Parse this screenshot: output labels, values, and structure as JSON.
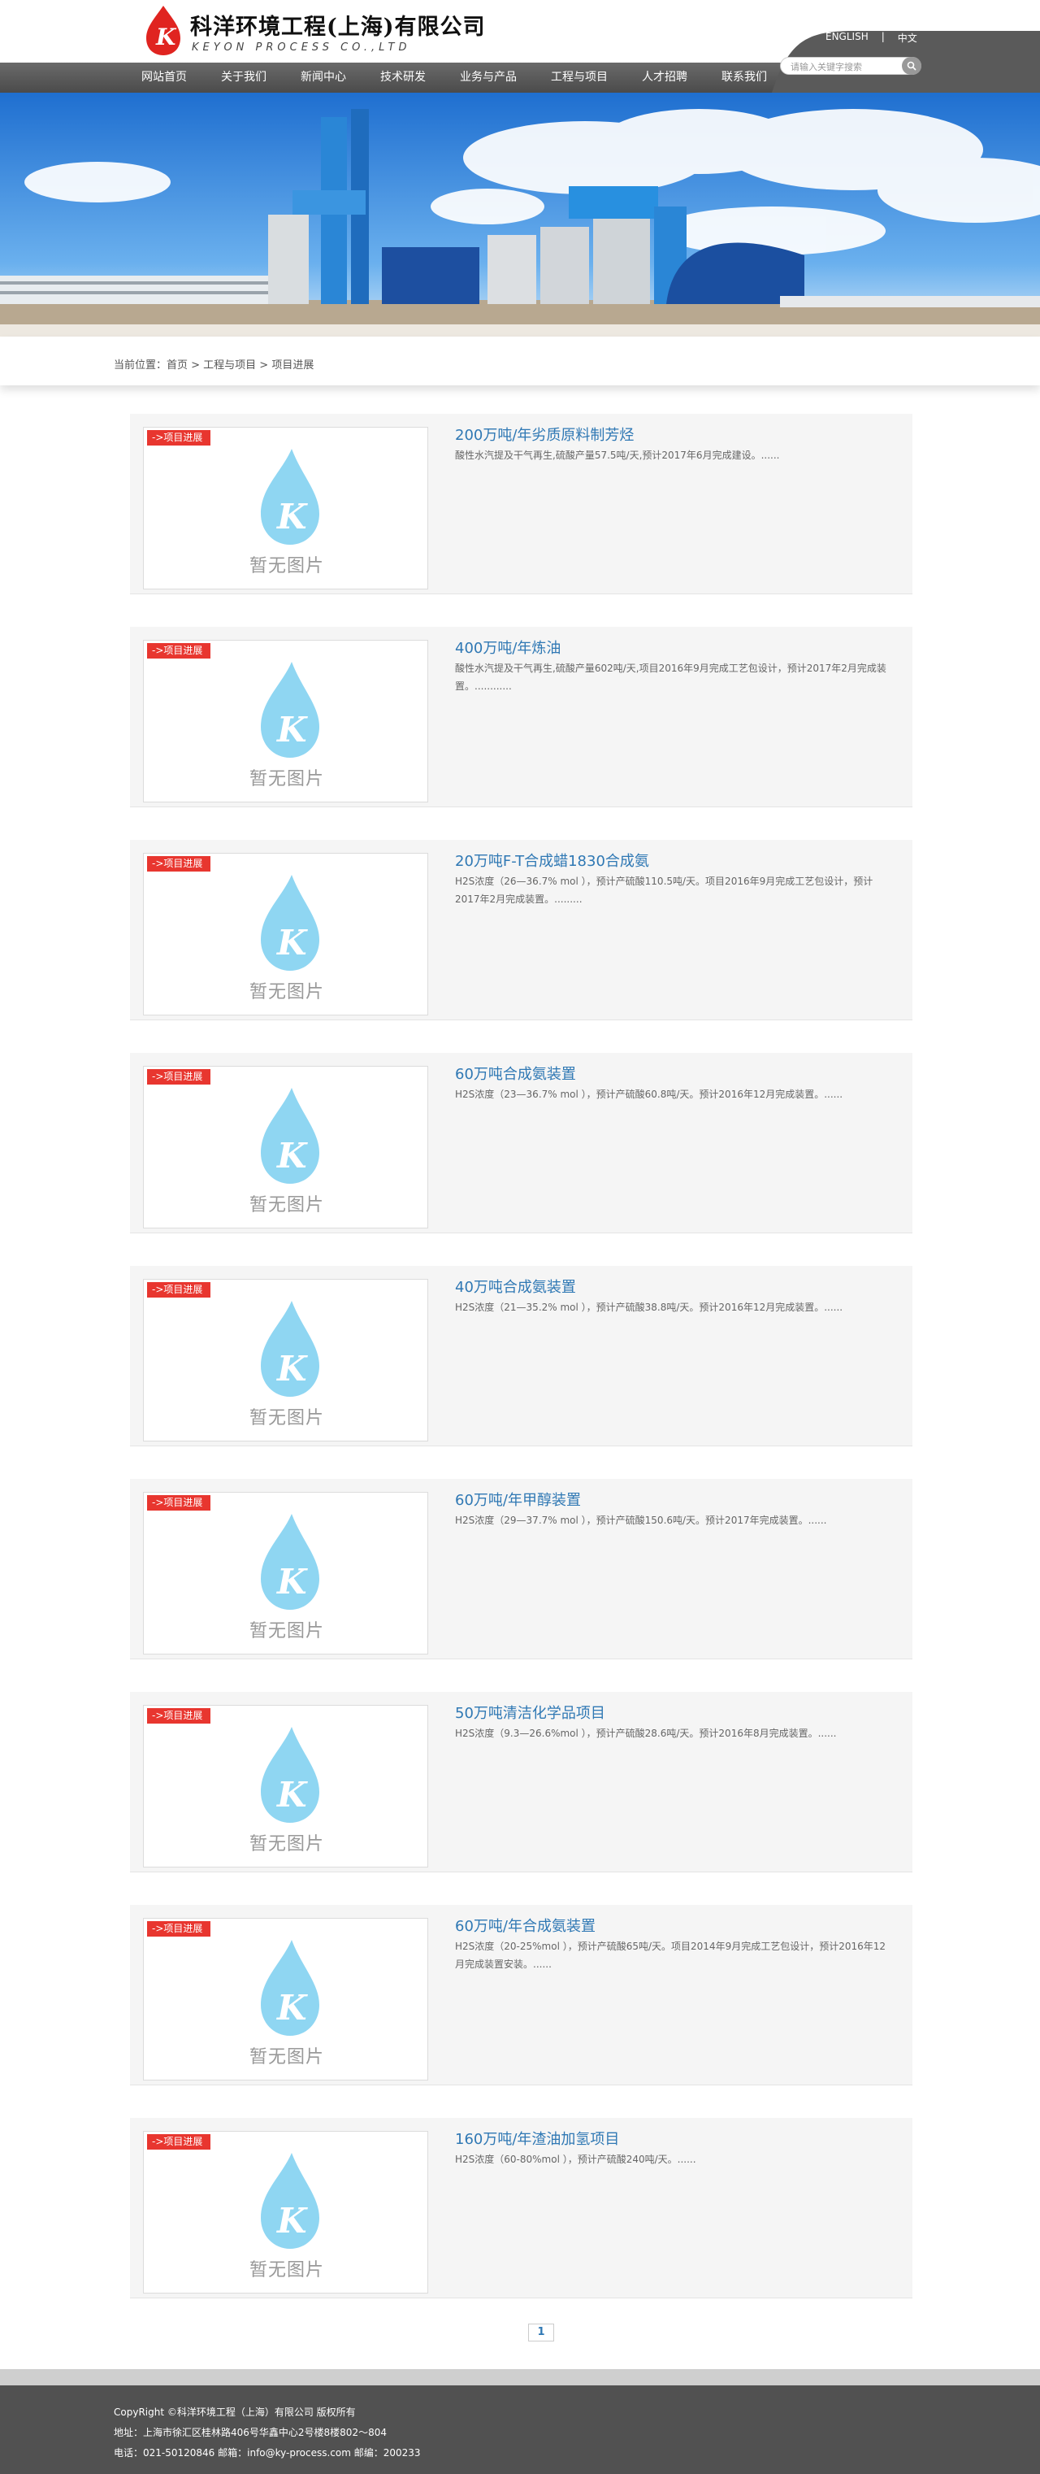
{
  "header": {
    "company_cn": "科洋环境工程(上海)有限公司",
    "company_en": "KEYON PROCESS CO.,LTD",
    "logo_letter": "K",
    "lang_en": "ENGLISH",
    "lang_sep": "|",
    "lang_cn": "中文",
    "search_placeholder": "请输入关键字搜索"
  },
  "nav": [
    "网站首页",
    "关于我们",
    "新闻中心",
    "技术研发",
    "业务与产品",
    "工程与项目",
    "人才招聘",
    "联系我们"
  ],
  "breadcrumb": "当前位置：首页 > 工程与项目 > 项目进展",
  "tag_label": "->项目进展",
  "no_image_text": "暂无图片",
  "items": [
    {
      "title": "200万吨/年劣质原料制芳烃",
      "desc": "酸性水汽提及干气再生,硫酸产量57.5吨/天,预计2017年6月完成建设。......"
    },
    {
      "title": "400万吨/年炼油",
      "desc": "酸性水汽提及干气再生,硫酸产量602吨/天,项目2016年9月完成工艺包设计，预计2017年2月完成装置。............"
    },
    {
      "title": "20万吨F-T合成蜡1830合成氨",
      "desc": "H2S浓度（26—36.7% mol ），预计产硫酸110.5吨/天。项目2016年9月完成工艺包设计，预计2017年2月完成装置。........."
    },
    {
      "title": "60万吨合成氨装置",
      "desc": "H2S浓度（23—36.7% mol ），预计产硫酸60.8吨/天。预计2016年12月完成装置。......"
    },
    {
      "title": "40万吨合成氨装置",
      "desc": "H2S浓度（21—35.2% mol ），预计产硫酸38.8吨/天。预计2016年12月完成装置。......"
    },
    {
      "title": "60万吨/年甲醇装置",
      "desc": "H2S浓度（29—37.7% mol ），预计产硫酸150.6吨/天。预计2017年完成装置。......"
    },
    {
      "title": "50万吨清洁化学品项目",
      "desc": "H2S浓度（9.3—26.6%mol ），预计产硫酸28.6吨/天。预计2016年8月完成装置。......"
    },
    {
      "title": "60万吨/年合成氨装置",
      "desc": "H2S浓度（20-25%mol ），预计产硫酸65吨/天。项目2014年9月完成工艺包设计，预计2016年12月完成装置安装。......"
    },
    {
      "title": "160万吨/年渣油加氢项目",
      "desc": "H2S浓度（60-80%mol ），预计产硫酸240吨/天。......"
    }
  ],
  "pager": {
    "current": "1"
  },
  "footer": {
    "copyright": "CopyRight ©科洋环境工程（上海）有限公司 版权所有",
    "address": "地址：上海市徐汇区桂林路406号华鑫中心2号楼8楼802～804",
    "contact": "电话：021-50120846 邮箱：info@ky-process.com 邮编：200233"
  },
  "colors": {
    "nav_bg": "#555555",
    "accent_red": "#e8362f",
    "title_blue": "#2f78b4",
    "drop_blue": "#8fd6f2",
    "footer_bg": "#515151"
  }
}
